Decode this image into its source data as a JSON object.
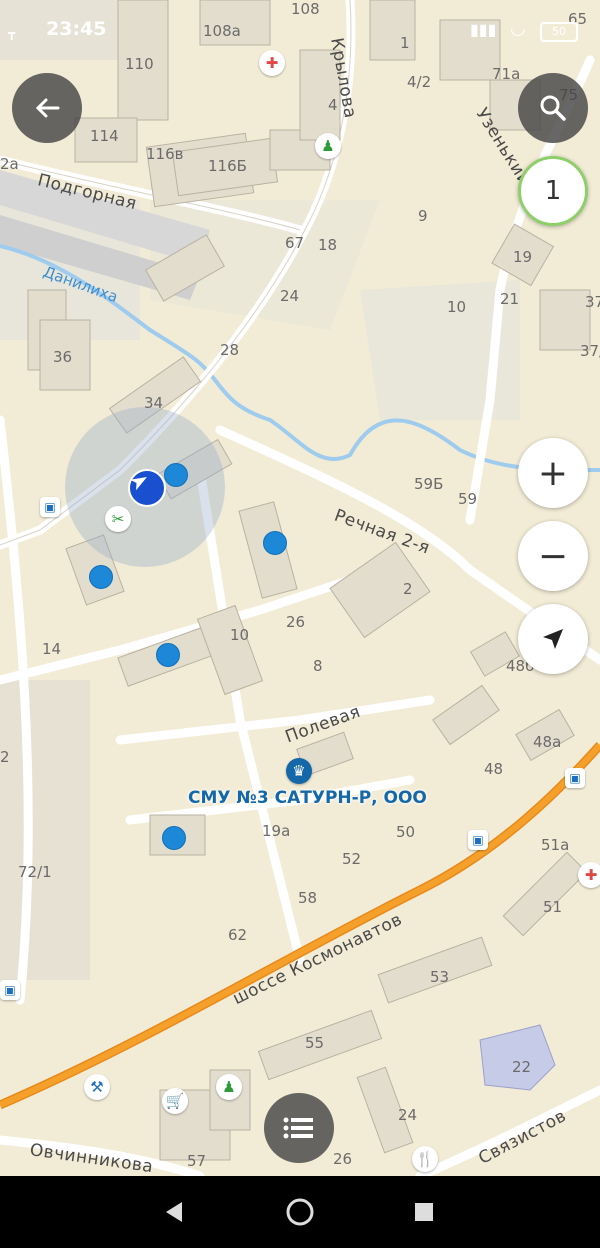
{
  "status_bar": {
    "time": "23:45",
    "battery": "50"
  },
  "controls": {
    "back_icon": "arrow-left-icon",
    "search_icon": "search-icon",
    "layer_badge": "1",
    "zoom_in": "+",
    "zoom_out": "−",
    "location_icon": "navigation-arrow-icon",
    "list_icon": "list-icon"
  },
  "map": {
    "selected_place": "СМУ №3 САТУРН-Р, ООО",
    "streets": {
      "podgornaya": "Подгорная",
      "krylova": "Крылова",
      "uzenkiy": "Узенький",
      "rechnaya": "Речная 2-я",
      "polevaya": "Полевая",
      "kosmonavtov": "шоссе Космонавтов",
      "ovchinnikova": "Овчинникова",
      "svyazistov": "Связистов"
    },
    "river": "Данилиха",
    "house_numbers": {
      "h108": "108",
      "h108a": "108а",
      "h110": "110",
      "h1": "1",
      "h65": "65",
      "h42": "4/2",
      "h71a": "71а",
      "h75": "75",
      "h4": "4",
      "h114": "114",
      "h116v": "116в",
      "h116b": "116Б",
      "h2a": "2а",
      "h9": "9",
      "h67": "67",
      "h18": "18",
      "h19": "19",
      "h24": "24",
      "h10top": "10",
      "h21": "21",
      "h37": "37",
      "h37slash": "37/",
      "h36": "36",
      "h28": "28",
      "h34": "34",
      "h59b": "59Б",
      "h59": "59",
      "h2": "2",
      "h26": "26",
      "h10": "10",
      "h14": "14",
      "h8": "8",
      "h48b": "48б",
      "h48a": "48а",
      "h48": "48",
      "h2l": "2",
      "h19a": "19а",
      "h50": "50",
      "h52": "52",
      "h58": "58",
      "h721": "72/1",
      "h51a": "51а",
      "h51": "51",
      "h62": "62",
      "h53": "53",
      "h55": "55",
      "h22": "22",
      "h24b": "24",
      "h57": "57",
      "h26b": "26",
      "h1top": "1"
    }
  }
}
